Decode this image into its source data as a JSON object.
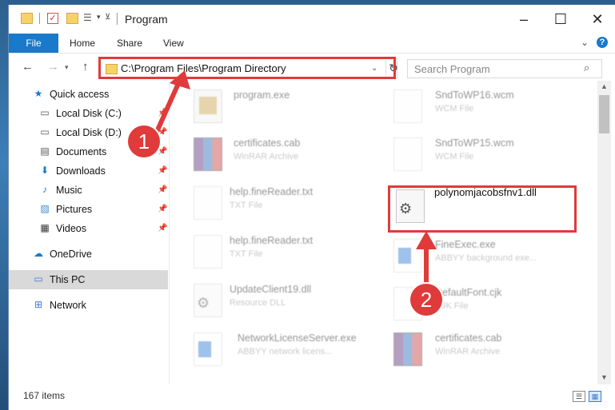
{
  "window": {
    "title": "Program"
  },
  "ribbon": {
    "file": "File",
    "home": "Home",
    "share": "Share",
    "view": "View"
  },
  "address": {
    "path": "C:\\Program Files\\Program Directory"
  },
  "search": {
    "placeholder": "Search Program"
  },
  "sidebar": {
    "items": [
      {
        "label": "Quick access",
        "icon": "star-icon"
      },
      {
        "label": "Local Disk (C:)",
        "icon": "drive-icon"
      },
      {
        "label": "Local Disk (D:)",
        "icon": "drive-icon"
      },
      {
        "label": "Documents",
        "icon": "documents-icon"
      },
      {
        "label": "Downloads",
        "icon": "download-icon"
      },
      {
        "label": "Music",
        "icon": "music-icon"
      },
      {
        "label": "Pictures",
        "icon": "pictures-icon"
      },
      {
        "label": "Videos",
        "icon": "videos-icon"
      },
      {
        "label": "OneDrive",
        "icon": "cloud-icon"
      },
      {
        "label": "This PC",
        "icon": "pc-icon"
      },
      {
        "label": "Network",
        "icon": "network-icon"
      }
    ]
  },
  "files": {
    "col1": [
      {
        "name": "program.exe",
        "type": ""
      },
      {
        "name": "certificates.cab",
        "type": "WinRAR Archive"
      },
      {
        "name": "help.fineReader.txt",
        "type": "TXT File"
      },
      {
        "name": "help.fineReader.txt",
        "type": "TXT File"
      },
      {
        "name": "UpdateClient19.dll",
        "type": "Resource DLL"
      },
      {
        "name": "NetworkLicenseServer.exe",
        "type": "ABBYY network licens..."
      }
    ],
    "col2": [
      {
        "name": "SndToWP16.wcm",
        "type": "WCM File"
      },
      {
        "name": "SndToWP15.wcm",
        "type": "WCM File"
      },
      {
        "name": "polynomjacobsfnv1.dll",
        "type": ""
      },
      {
        "name": "FineExec.exe",
        "type": "ABBYY background exe..."
      },
      {
        "name": "DefaultFont.cjk",
        "type": "CJK File"
      },
      {
        "name": "certificates.cab",
        "type": "WinRAR Archive"
      }
    ]
  },
  "status": {
    "count": "167 items"
  },
  "annotations": {
    "step1": "1",
    "step2": "2",
    "color": "#e03a3a"
  }
}
